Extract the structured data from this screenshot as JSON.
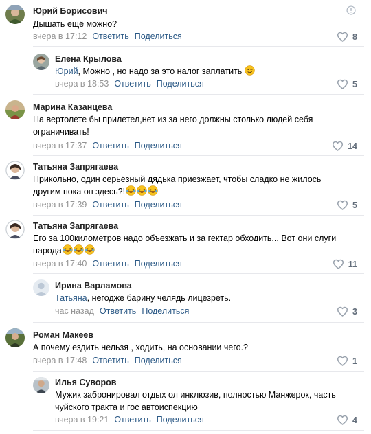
{
  "comments": [
    {
      "author": "Юрий Борисович",
      "text": "Дышать ещё можно?",
      "time": "вчера в 17:12",
      "reply": "Ответить",
      "share": "Поделиться",
      "likes": "8"
    },
    {
      "author": "Елена Крылова",
      "reply_to": "Юрий",
      "text": ", Можно , но надо за это налог заплатить",
      "time": "вчера в 18:53",
      "reply": "Ответить",
      "share": "Поделиться",
      "likes": "5"
    },
    {
      "author": "Марина Казанцева",
      "text": "На вертолете бы прилетел,нет из за него должны столько людей себя ограничивать!",
      "time": "вчера в 17:37",
      "reply": "Ответить",
      "share": "Поделиться",
      "likes": "14"
    },
    {
      "author": "Татьяна Запрягаева",
      "text": "Прикольно, один серьёзный дядька приезжает, чтобы сладко не жилось другим пока он здесь?!",
      "time": "вчера в 17:39",
      "reply": "Ответить",
      "share": "Поделиться",
      "likes": "5"
    },
    {
      "author": "Татьяна Запрягаева",
      "text": "Его за 100километров надо объезжать и за гектар обходить... Вот они слуги народа",
      "time": "вчера в 17:40",
      "reply": "Ответить",
      "share": "Поделиться",
      "likes": "11"
    },
    {
      "author": "Ирина Варламова",
      "reply_to": "Татьяна",
      "text": ", негодже барину челядь лицезреть.",
      "time": "час назад",
      "reply": "Ответить",
      "share": "Поделиться",
      "likes": "3"
    },
    {
      "author": "Роман Макеев",
      "text": "А почему ездить нельзя , ходить, на основании чего.?",
      "time": "вчера в 17:48",
      "reply": "Ответить",
      "share": "Поделиться",
      "likes": "1"
    },
    {
      "author": "Илья Суворов",
      "text": "Мужик забронировал отдых ол инклюзив, полностью Манжерок, часть чуйского тракта и гос автоиспекцию",
      "time": "вчера в 19:21",
      "reply": "Ответить",
      "share": "Поделиться",
      "likes": "4"
    }
  ],
  "icons": {
    "like": "heart-outline-icon",
    "report": "report-icon",
    "emoji_wink": "winking-face-emoji",
    "emoji_laugh": "face-with-tears-of-joy-emoji"
  },
  "colors": {
    "link": "#2a5885",
    "meta": "#939393",
    "likes": "#626d7a",
    "divider": "#e7e8ec",
    "emoji": "#f7c21e"
  }
}
